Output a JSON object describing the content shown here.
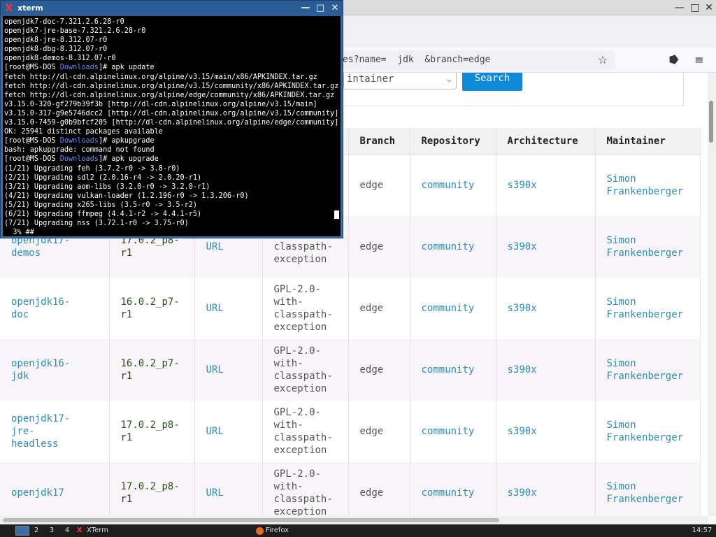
{
  "firefox": {
    "url_parts": [
      "es?name=",
      "jdk",
      "&branch=edge"
    ],
    "select_value": "intainer",
    "search_label": "Search",
    "titlebar_icons": [
      "minimize-icon",
      "restore-icon",
      "close-icon"
    ]
  },
  "table": {
    "headers": [
      "",
      "",
      "",
      "",
      "Branch",
      "Repository",
      "Architecture",
      "Maintainer"
    ],
    "rows": [
      {
        "name": "",
        "version": "",
        "url": "",
        "license": "",
        "branch": "edge",
        "repo": "community",
        "arch": "s390x",
        "maint": "Simon\nFrankenberger"
      },
      {
        "name": "openjdk17-\ndemos",
        "version": "17.0.2_p8-\nr1",
        "url": "URL",
        "license": "with-\nclasspath-\nexception",
        "branch": "edge",
        "repo": "community",
        "arch": "s390x",
        "maint": "Simon\nFrankenberger"
      },
      {
        "name": "openjdk16-\ndoc",
        "version": "16.0.2_p7-\nr1",
        "url": "URL",
        "license": "GPL-2.0-\nwith-\nclasspath-\nexception",
        "branch": "edge",
        "repo": "community",
        "arch": "s390x",
        "maint": "Simon\nFrankenberger"
      },
      {
        "name": "openjdk16-\njdk",
        "version": "16.0.2_p7-\nr1",
        "url": "URL",
        "license": "GPL-2.0-\nwith-\nclasspath-\nexception",
        "branch": "edge",
        "repo": "community",
        "arch": "s390x",
        "maint": "Simon\nFrankenberger"
      },
      {
        "name": "openjdk17-\njre-\nheadless",
        "version": "17.0.2_p8-\nr1",
        "url": "URL",
        "license": "GPL-2.0-\nwith-\nclasspath-\nexception",
        "branch": "edge",
        "repo": "community",
        "arch": "s390x",
        "maint": "Simon\nFrankenberger"
      },
      {
        "name": "openjdk17",
        "version": "17.0.2_p8-\nr1",
        "url": "URL",
        "license": "GPL-2.0-\nwith-\nclasspath-\nexception",
        "branch": "edge",
        "repo": "community",
        "arch": "s390x",
        "maint": "Simon\nFrankenberger"
      }
    ]
  },
  "xterm": {
    "title": "xterm",
    "lines": [
      "openjdk7-doc-7.321.2.6.28-r0",
      "openjdk7-jre-base-7.321.2.6.28-r0",
      "openjdk8-jre-8.312.07-r0",
      "openjdk8-dbg-8.312.07-r0",
      "openjdk8-demos-8.312.07-r0",
      "[root@MS-DOS Downloads]# apk update",
      "fetch http://dl-cdn.alpinelinux.org/alpine/v3.15/main/x86/APKINDEX.tar.gz",
      "fetch http://dl-cdn.alpinelinux.org/alpine/v3.15/community/x86/APKINDEX.tar.gz",
      "fetch http://dl-cdn.alpinelinux.org/alpine/edge/community/x86/APKINDEX.tar.gz",
      "v3.15.0-320-gf279b39f3b [http://dl-cdn.alpinelinux.org/alpine/v3.15/main]",
      "v3.15.0-317-g9e5746dcc2 [http://dl-cdn.alpinelinux.org/alpine/v3.15/community]",
      "v3.15.0-7459-g0b9bfcf205 [http://dl-cdn.alpinelinux.org/alpine/edge/community]",
      "OK: 25941 distinct packages available",
      "[root@MS-DOS Downloads]# apkupgrade",
      "bash: apkupgrade: command not found",
      "[root@MS-DOS Downloads]# apk upgrade",
      "(1/21) Upgrading feh (3.7.2-r0 -> 3.8-r0)",
      "(2/21) Upgrading sdl2 (2.0.16-r4 -> 2.0.20-r1)",
      "(3/21) Upgrading aom-libs (3.2.0-r0 -> 3.2.0-r1)",
      "(4/21) Upgrading vulkan-loader (1.2.196-r0 -> 1.3.206-r0)",
      "(5/21) Upgrading x265-libs (3.5-r0 -> 3.5-r2)",
      "(6/21) Upgrading ffmpeg (4.4.1-r2 -> 4.4.1-r5)",
      "(7/21) Upgrading nss (3.72.1-r0 -> 3.75-r0)",
      "  3% ##"
    ]
  },
  "taskbar": {
    "workspaces": [
      "2",
      "3",
      "4"
    ],
    "tasks": [
      "XTerm",
      "Firefox"
    ],
    "clock": "14:57"
  }
}
